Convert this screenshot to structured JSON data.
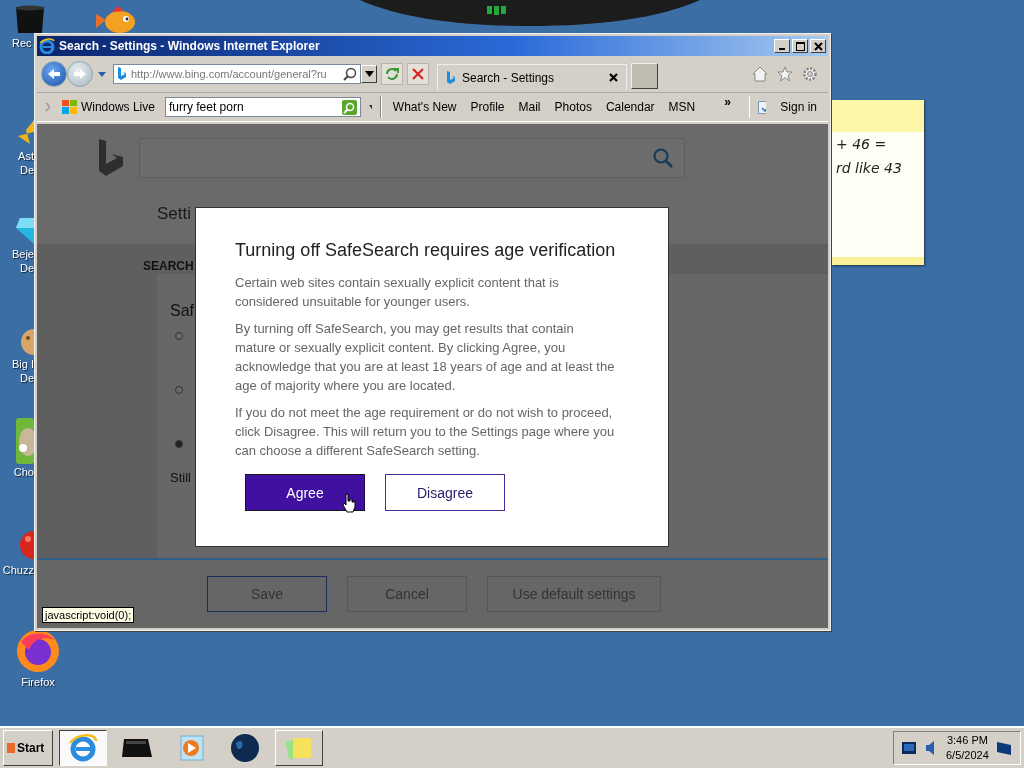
{
  "desktop": {
    "icons": [
      {
        "kind": "bin",
        "lines": [
          "Rec"
        ]
      },
      {
        "kind": "fish"
      },
      {
        "kind": "star",
        "lines": [
          "Ast",
          "De"
        ]
      },
      {
        "kind": "gem",
        "lines": [
          "Beje",
          "De"
        ]
      },
      {
        "kind": "cookie",
        "lines": [
          "Big I",
          "De"
        ]
      },
      {
        "kind": "dog",
        "lines": [
          "Cho"
        ]
      },
      {
        "kind": "ball",
        "lines": [
          "Chuzz"
        ]
      },
      {
        "kind": "firefox",
        "lines": [
          "Firefox"
        ]
      }
    ]
  },
  "sticky_note": {
    "lines": [
      "+ 46 =",
      "rd like 43"
    ]
  },
  "browser": {
    "title": "Search - Settings - Windows Internet Explorer",
    "address": "http://www.bing.com/account/general?ru",
    "tab": {
      "title": "Search - Settings"
    },
    "favorites_bar": {
      "brand": "Windows Live",
      "search_value": "furry feet porn",
      "links": [
        "What's New",
        "Profile",
        "Mail",
        "Photos",
        "Calendar",
        "MSN"
      ],
      "more": "»",
      "sign_in": "Sign in"
    },
    "status_tip": "javascript:void(0);"
  },
  "page": {
    "heading": "Setti",
    "section": "SEARCH",
    "card_title": "Saf",
    "radios": [
      {
        "selected": false
      },
      {
        "selected": false
      },
      {
        "selected": true
      }
    ],
    "note": "Still",
    "buttons": [
      "Save",
      "Cancel",
      "Use default settings"
    ]
  },
  "dialog": {
    "title": "Turning off SafeSearch requires age verification",
    "paragraphs": [
      "Certain web sites contain sexually explicit content that is considered unsuitable for younger users.",
      "By turning off SafeSearch, you may get results that contain mature or sexually explicit content. By clicking Agree, you acknowledge that you are at least 18 years of age and at least the age of majority where you are located.",
      "If you do not meet the age requirement or do not wish to proceed, click Disagree. This will return you to the Settings page where you can choose a different SafeSearch setting."
    ],
    "buttons": [
      {
        "label": "Agree",
        "kind": "primary"
      },
      {
        "label": "Disagree",
        "kind": "secondary"
      }
    ]
  },
  "taskbar": {
    "start": "Start",
    "items": [
      {
        "kind": "ie",
        "running": true,
        "selected": true
      },
      {
        "kind": "device",
        "running": false,
        "selected": false
      },
      {
        "kind": "media",
        "running": false,
        "selected": false
      },
      {
        "kind": "globe",
        "running": false,
        "selected": false
      },
      {
        "kind": "notes",
        "running": true,
        "selected": false
      }
    ],
    "clock": {
      "time": "3:46 PM",
      "date": "6/5/2024"
    }
  }
}
